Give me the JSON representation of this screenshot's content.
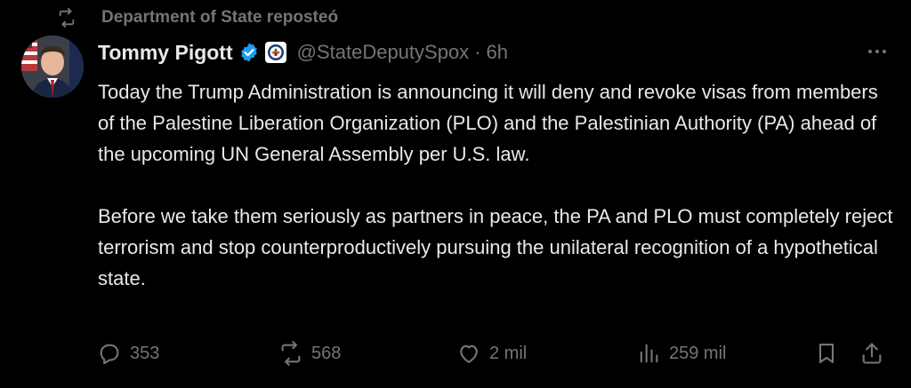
{
  "repost_banner": {
    "text": "Department of State reposteó",
    "icon": "repost-icon"
  },
  "tweet": {
    "author": {
      "display_name": "Tommy Pigott",
      "handle": "@StateDeputySpox",
      "verified_icon": "verified-badge-icon",
      "affiliate_badge": "state-department-seal-icon",
      "avatar": "avatar"
    },
    "separator": "·",
    "time": "6h",
    "more_icon": "more-horizontal-icon",
    "body": {
      "paragraph_1": "Today the Trump Administration is announcing it will deny and revoke visas from members of the Palestine Liberation Organization (PLO) and the Palestinian Authority (PA) ahead of the upcoming UN General Assembly per U.S. law.",
      "paragraph_2": "Before we take them seriously as partners in peace, the PA and PLO must completely reject terrorism and stop counterproductively pursuing the unilateral recognition of a hypothetical state."
    },
    "actions": {
      "reply": {
        "icon": "reply-icon",
        "count": "353"
      },
      "repost": {
        "icon": "repost-icon",
        "count": "568"
      },
      "like": {
        "icon": "heart-icon",
        "count": "2 mil"
      },
      "views": {
        "icon": "views-icon",
        "count": "259 mil"
      },
      "bookmark": {
        "icon": "bookmark-icon"
      },
      "share": {
        "icon": "share-icon"
      }
    }
  },
  "colors": {
    "background": "#000000",
    "text_primary": "#e7e9ea",
    "text_secondary": "#71767b",
    "verified_blue": "#1d9bf0"
  }
}
